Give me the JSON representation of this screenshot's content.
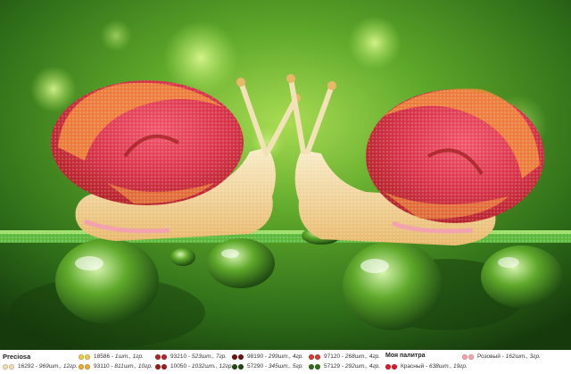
{
  "legend": {
    "brand": "Preciosa",
    "palette_title": "Моя палитра",
    "colors": [
      {
        "code": "16292",
        "amount": "969шт., 12гр.",
        "color": "#efd9b0"
      },
      {
        "code": "18586",
        "amount": "1шт., 1гр.",
        "color": "#e8c84a"
      },
      {
        "code": "93110",
        "amount": "811шт., 10гр.",
        "color": "#e6a93a"
      },
      {
        "code": "93210",
        "amount": "523шт., 7гр.",
        "color": "#b5222a"
      },
      {
        "code": "10050",
        "amount": "1032шт., 12гр.",
        "color": "#9b1d1d"
      },
      {
        "code": "98190",
        "amount": "299шт., 4гр.",
        "color": "#6e1212"
      },
      {
        "code": "57290",
        "amount": "345шт., 5гр.",
        "color": "#1f4a14"
      },
      {
        "code": "97120",
        "amount": "268шт., 4гр.",
        "color": "#d73830"
      },
      {
        "code": "57129",
        "amount": "292шт., 4гр.",
        "color": "#2f6b1c"
      },
      {
        "code": "Красный",
        "amount": "638шт., 19гр.",
        "color": "#e0192a"
      },
      {
        "code": "Розовый",
        "amount": "162шт., 3гр.",
        "color": "#f2a3ad"
      }
    ]
  },
  "art": {
    "icon": "snails-on-grass-dewdrops-image",
    "colors": {
      "bg_dark": "#1f4a12",
      "bg_light": "#8fd040",
      "shell_red": "#d9334a",
      "shell_orange": "#f08a3a",
      "body_cream": "#f3e2b8",
      "grass": "#5cb83a",
      "drop": "#6fb04a"
    }
  }
}
